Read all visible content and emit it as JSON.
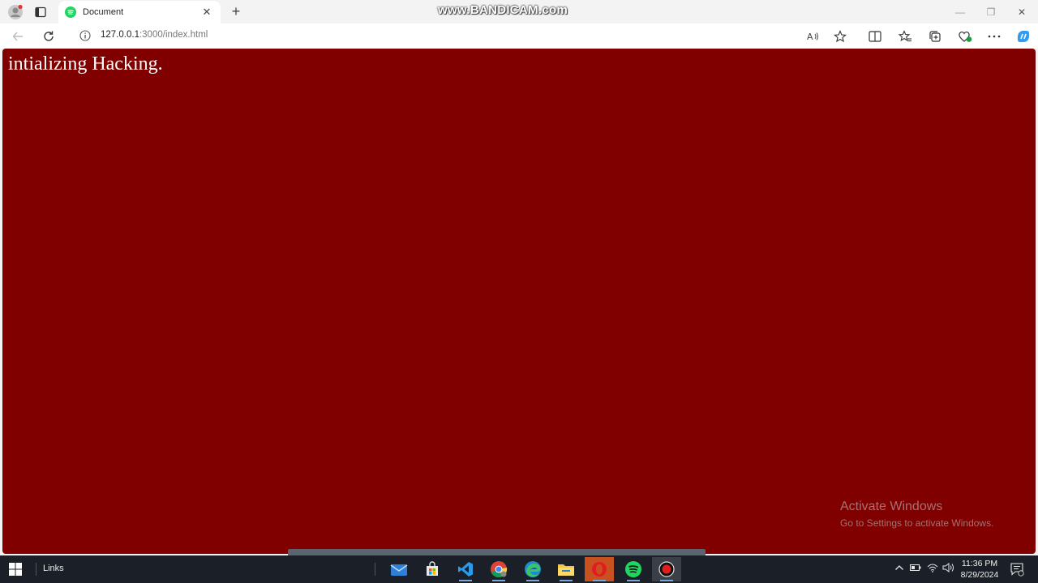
{
  "browser": {
    "tab_title": "Document",
    "tab_close": "✕",
    "new_tab": "+",
    "url_host": "127.0.0.1",
    "url_path": ":3000/index.html",
    "minimize": "—",
    "restore": "❐",
    "close": "✕"
  },
  "watermark": "www.BANDICAM.com",
  "page": {
    "text": "intializing Hacking.",
    "background": "#800000",
    "text_color": "#ffffff"
  },
  "activate_windows": {
    "title": "Activate Windows",
    "subtitle": "Go to Settings to activate Windows."
  },
  "taskbar": {
    "links_label": "Links",
    "time": "11:36 PM",
    "date": "8/29/2024",
    "apps": [
      "mail-icon",
      "store-icon",
      "vscode-icon",
      "chrome-icon",
      "edge-icon",
      "file-explorer-icon",
      "opera-icon",
      "spotify-icon",
      "bandicam-icon"
    ]
  }
}
